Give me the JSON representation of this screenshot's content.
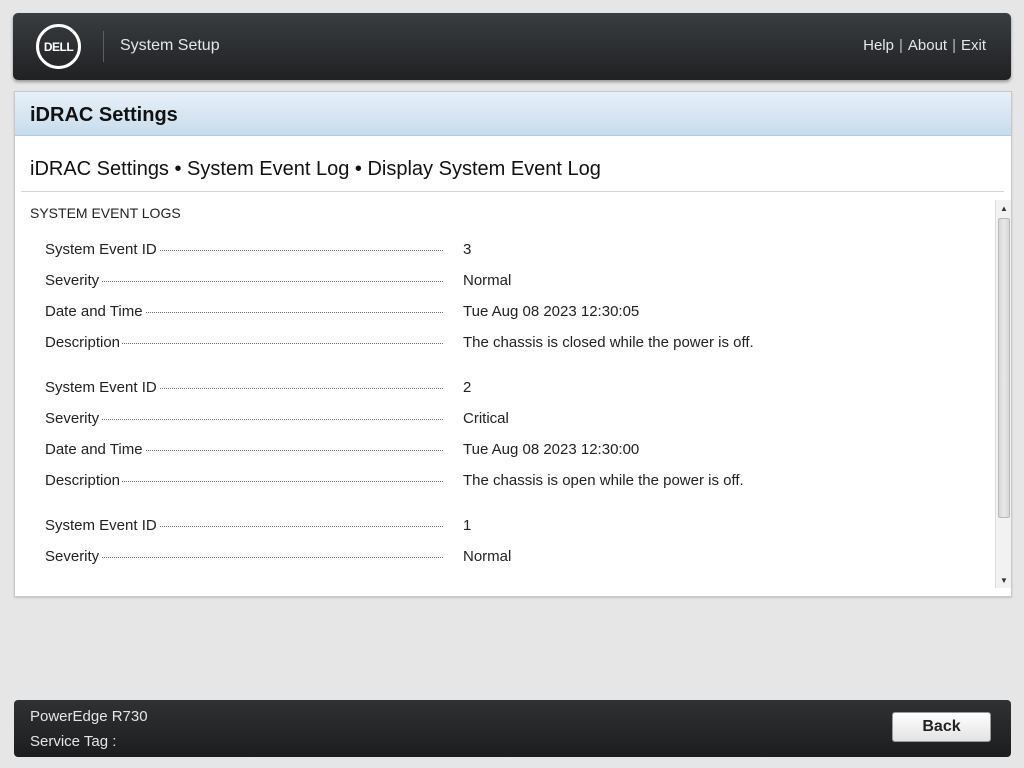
{
  "header": {
    "logo_text": "DELL",
    "app_title": "System Setup",
    "links": [
      "Help",
      "About",
      "Exit"
    ],
    "separator": "|"
  },
  "panel": {
    "title": "iDRAC Settings",
    "breadcrumb": "iDRAC Settings • System Event Log • Display System Event Log",
    "section_title": "SYSTEM EVENT LOGS"
  },
  "events": [
    {
      "id_label": "System Event ID",
      "id": "3",
      "severity_label": "Severity",
      "severity": "Normal",
      "datetime_label": "Date and Time",
      "datetime": "Tue Aug 08 2023 12:30:05",
      "description_label": "Description",
      "description": "The chassis is closed while the power is off."
    },
    {
      "id_label": "System Event ID",
      "id": "2",
      "severity_label": "Severity",
      "severity": "Critical",
      "datetime_label": "Date and Time",
      "datetime": "Tue Aug 08 2023 12:30:00",
      "description_label": "Description",
      "description": "The chassis is open while the power is off."
    },
    {
      "id_label": "System Event ID",
      "id": "1",
      "severity_label": "Severity",
      "severity": "Normal"
    }
  ],
  "footer": {
    "model": "PowerEdge R730",
    "service_tag_label": "Service Tag :",
    "back_label": "Back"
  }
}
